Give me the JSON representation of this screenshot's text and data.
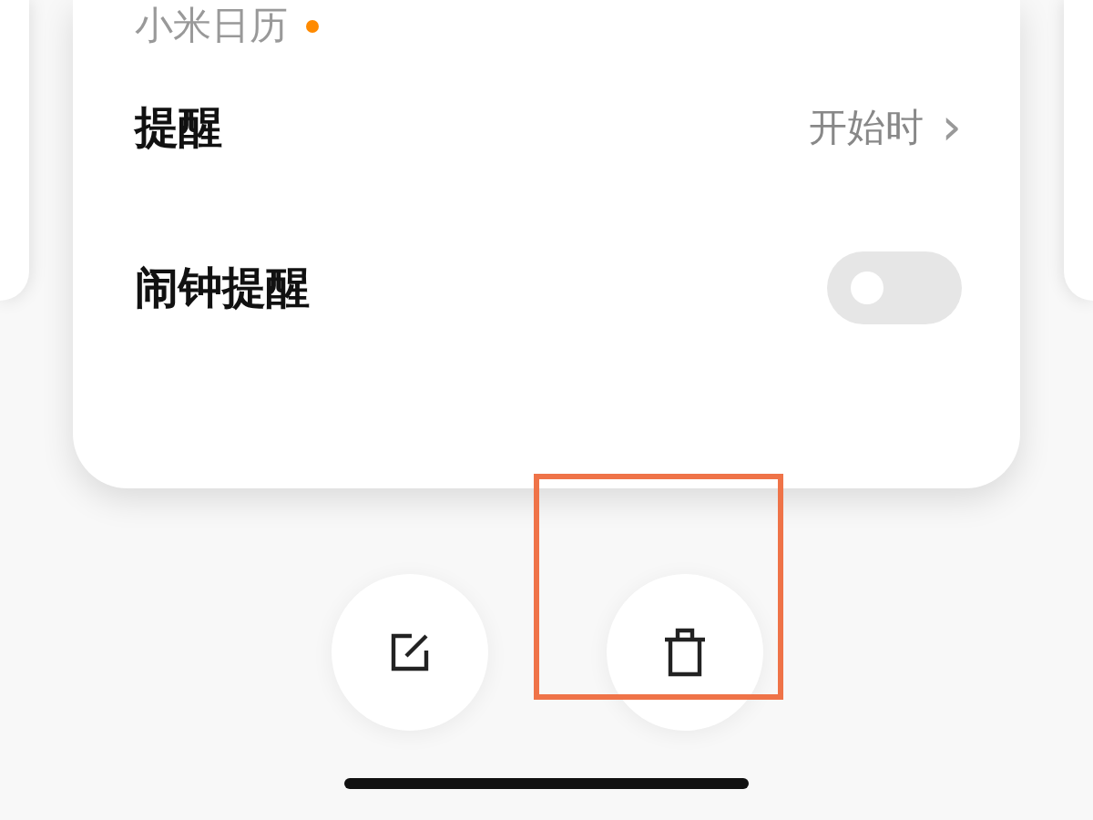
{
  "calendar": {
    "label": "小米日历",
    "color": "#ff8a00"
  },
  "rows": [
    {
      "kind": "link",
      "label": "提醒",
      "value": "开始时",
      "chevron": "›"
    },
    {
      "kind": "toggle",
      "label": "闹钟提醒",
      "on": false
    }
  ],
  "actions": [
    {
      "kind": "edit",
      "highlighted": false
    },
    {
      "kind": "delete",
      "highlighted": true
    }
  ]
}
